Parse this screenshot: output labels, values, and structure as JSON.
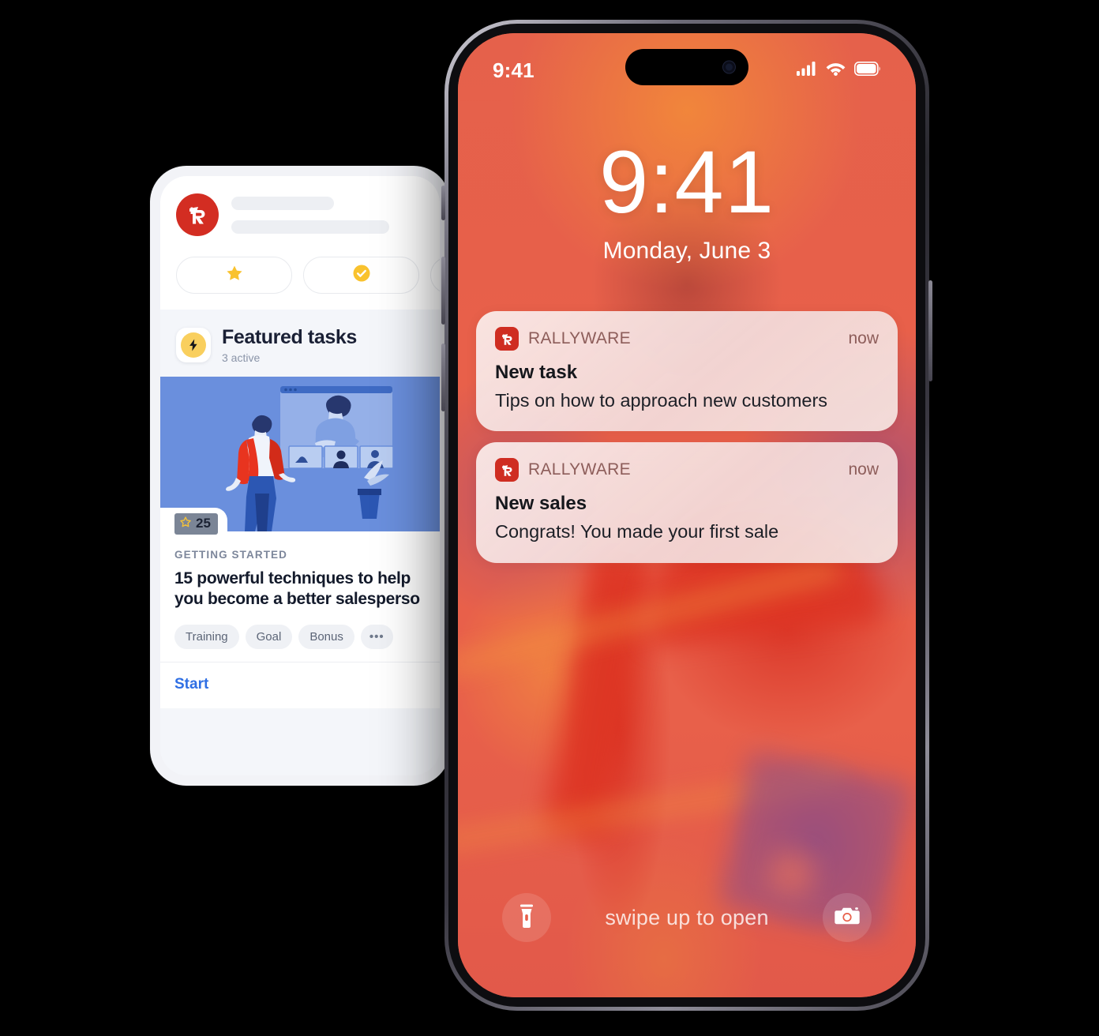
{
  "brand": {
    "name": "RALLYWARE",
    "accent_red": "#d32d22",
    "notif_icon_red": "#cf2d21"
  },
  "left_phone": {
    "app_header": {
      "logo_icon": "rallyware-logo-icon",
      "skeleton_lines": [
        "",
        ""
      ],
      "chips": [
        {
          "icon": "star-icon"
        },
        {
          "icon": "check-circle-icon"
        },
        {
          "icon": "partial-chip"
        }
      ]
    },
    "featured_section": {
      "icon": "lightning-bolt-icon",
      "title": "Featured tasks",
      "subtitle": "3 active"
    },
    "task_card": {
      "illustration_alt": "salesperson-presentation-illustration",
      "points_badge": {
        "icon": "star-outline-icon",
        "value": "25"
      },
      "kicker": "GETTING STARTED",
      "title_line1": "15 powerful techniques to help",
      "title_line2": "you become a better salesperso",
      "tags": [
        "Training",
        "Goal",
        "Bonus"
      ],
      "more_tags": "•••",
      "start_label": "Start",
      "start_color": "#2f6fe4"
    }
  },
  "right_phone": {
    "status_bar": {
      "time": "9:41",
      "icons": [
        "cellular-signal-icon",
        "wifi-icon",
        "battery-icon"
      ]
    },
    "lock_screen": {
      "clock": "9:41",
      "date": "Monday, June 3"
    },
    "notifications": [
      {
        "app": "RALLYWARE",
        "time": "now",
        "title": "New task",
        "message": "Tips on how to approach new customers"
      },
      {
        "app": "RALLYWARE",
        "time": "now",
        "title": "New sales",
        "message": "Congrats! You made your first sale"
      }
    ],
    "bottom_bar": {
      "flashlight_icon": "flashlight-icon",
      "hint": "swipe up to open",
      "camera_icon": "camera-icon"
    }
  }
}
